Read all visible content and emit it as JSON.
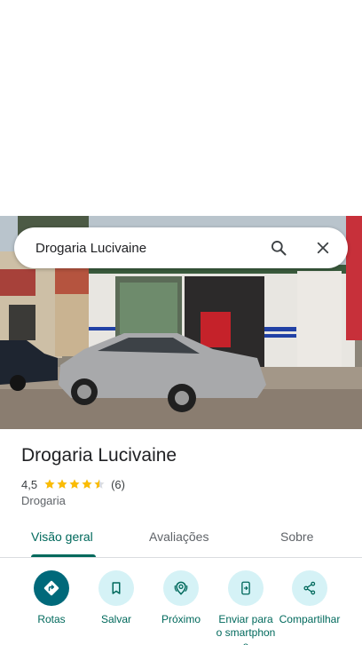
{
  "search": {
    "value": "Drogaria Lucivaine"
  },
  "place": {
    "title": "Drogaria Lucivaine",
    "rating": "4,5",
    "stars": 4.5,
    "review_count": "(6)",
    "category": "Drogaria"
  },
  "tabs": [
    {
      "label": "Visão geral",
      "active": true
    },
    {
      "label": "Avaliações",
      "active": false
    },
    {
      "label": "Sobre",
      "active": false
    }
  ],
  "actions": [
    {
      "label": "Rotas",
      "icon": "directions-icon"
    },
    {
      "label": "Salvar",
      "icon": "bookmark-icon"
    },
    {
      "label": "Próximo",
      "icon": "nearby-icon"
    },
    {
      "label": "Enviar para o smartphone",
      "icon": "send-to-phone-icon"
    },
    {
      "label": "Compartilhar",
      "icon": "share-icon"
    }
  ],
  "colors": {
    "accent": "#00695c",
    "primary_button": "#00697a",
    "action_button": "#d5f2f6",
    "star": "#fbbc04"
  }
}
